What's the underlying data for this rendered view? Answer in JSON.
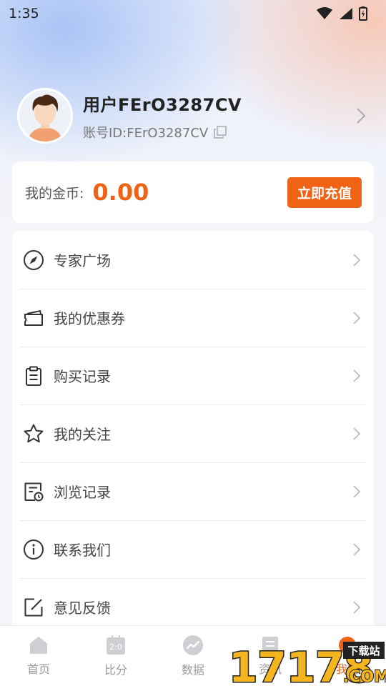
{
  "status_bar": {
    "time": "1:35"
  },
  "profile": {
    "username": "用户FErO3287CV",
    "account_id": "账号ID:FErO3287CV"
  },
  "coins": {
    "label": "我的金币:",
    "value": "0.00",
    "recharge_label": "立即充值"
  },
  "menu": {
    "items": [
      {
        "label": "专家广场",
        "icon": "compass-icon"
      },
      {
        "label": "我的优惠券",
        "icon": "coupon-icon"
      },
      {
        "label": "购买记录",
        "icon": "clipboard-icon"
      },
      {
        "label": "我的关注",
        "icon": "star-icon"
      },
      {
        "label": "浏览记录",
        "icon": "history-icon"
      },
      {
        "label": "联系我们",
        "icon": "info-icon"
      },
      {
        "label": "意见反馈",
        "icon": "edit-icon"
      }
    ]
  },
  "tabbar": {
    "tabs": [
      {
        "label": "首页",
        "icon": "home-icon"
      },
      {
        "label": "比分",
        "icon": "score-icon",
        "icon_text": "2:0"
      },
      {
        "label": "数据",
        "icon": "trend-icon"
      },
      {
        "label": "资讯",
        "icon": "news-icon"
      },
      {
        "label": "我的",
        "icon": "profile-icon"
      }
    ],
    "active_index": 4
  },
  "watermark": {
    "number": "17178",
    "badge": "下载站",
    "suffix": ".COM"
  },
  "colors": {
    "accent": "#f06214",
    "text": "#444444",
    "muted": "#999999"
  }
}
